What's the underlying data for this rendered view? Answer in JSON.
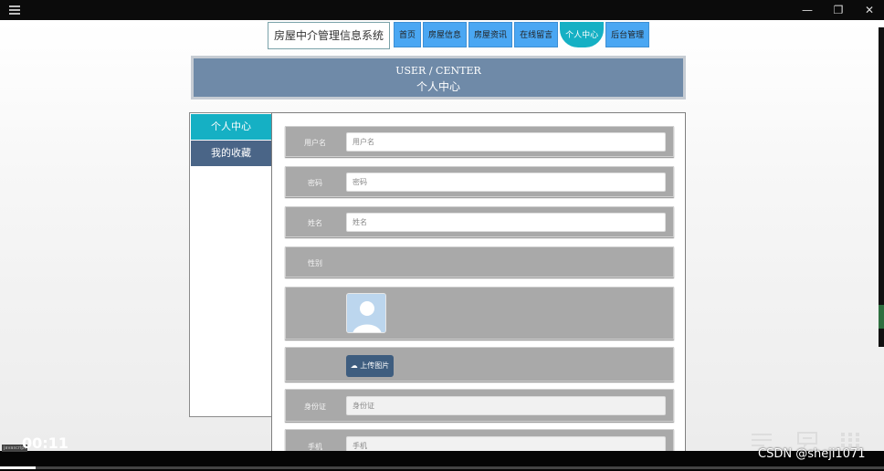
{
  "window": {
    "minimize": "—",
    "maximize": "❐",
    "close": "✕"
  },
  "nav": {
    "site_title": "房屋中介管理信息系统",
    "items": [
      "首页",
      "房屋信息",
      "房屋资讯",
      "在线留言",
      "个人中心",
      "后台管理"
    ],
    "active_index": 4
  },
  "banner": {
    "en": "USER / CENTER",
    "cn": "个人中心"
  },
  "sidebar": {
    "items": [
      "个人中心",
      "我的收藏"
    ]
  },
  "form": {
    "username_label": "用户名",
    "username_placeholder": "用户名",
    "password_label": "密码",
    "password_placeholder": "密码",
    "name_label": "姓名",
    "name_placeholder": "姓名",
    "gender_label": "性别",
    "upload_label": "上传图片",
    "idcard_label": "身份证",
    "idcard_placeholder": "身份证",
    "phone_label": "手机",
    "phone_placeholder": "手机"
  },
  "player": {
    "time": "00:11",
    "tag": "javascript",
    "progress": 0.04
  },
  "watermark": "CSDN @sheji1071",
  "colors": {
    "nav_blue": "#4aa7f3",
    "accent_teal": "#15b0c4",
    "banner": "#6f8aa8",
    "sidebar_dark": "#4a6587"
  }
}
